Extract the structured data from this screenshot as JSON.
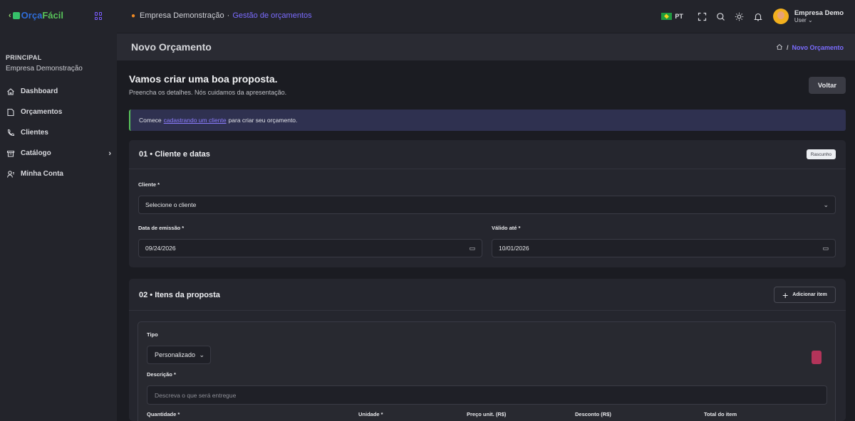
{
  "brand": {
    "part1": "Orça",
    "part2": "Fácil"
  },
  "sidebar": {
    "section": "PRINCIPAL",
    "company": "Empresa Demonstração",
    "items": [
      {
        "label": "Dashboard",
        "icon": "home-icon"
      },
      {
        "label": "Orçamentos",
        "icon": "document-icon"
      },
      {
        "label": "Clientes",
        "icon": "phone-icon"
      },
      {
        "label": "Catálogo",
        "icon": "box-icon",
        "chevron": "›"
      },
      {
        "label": "Minha Conta",
        "icon": "user-icon"
      }
    ]
  },
  "topbar": {
    "company": "Empresa Demonstração",
    "separator": "·",
    "module": "Gestão de orçamentos",
    "lang": "PT",
    "user_name": "Empresa Demo",
    "user_role": "User ⌄"
  },
  "page": {
    "title": "Novo Orçamento",
    "breadcrumb_sep": "/",
    "breadcrumb_current": "Novo Orçamento"
  },
  "hero": {
    "title": "Vamos criar uma boa proposta.",
    "subtitle": "Preencha os detalhes. Nós cuidamos da apresentação.",
    "back_label": "Voltar"
  },
  "alert": {
    "before": "Comece",
    "link": "cadastrando um cliente",
    "after": "para criar seu orçamento."
  },
  "section1": {
    "title": "01 • Cliente e datas",
    "badge": "Rascunho",
    "client_label": "Cliente *",
    "client_value": "Selecione o cliente",
    "issue_label": "Data de emissão *",
    "issue_value": "09/24/2026",
    "valid_label": "Válido até *",
    "valid_value": "10/01/2026"
  },
  "section2": {
    "title": "02 • Itens da proposta",
    "add_label": "Adicionar item",
    "type_label": "Tipo",
    "type_value": "Personalizado",
    "desc_label": "Descrição *",
    "desc_placeholder": "Descreva o que será entregue",
    "columns": [
      "Quantidade *",
      "Unidade *",
      "Preço unit. (R$)",
      "Desconto (R$)",
      "Total do item"
    ]
  },
  "colors": {
    "accent": "#7b6cff",
    "success": "#58c35a",
    "danger": "#b3345a"
  }
}
